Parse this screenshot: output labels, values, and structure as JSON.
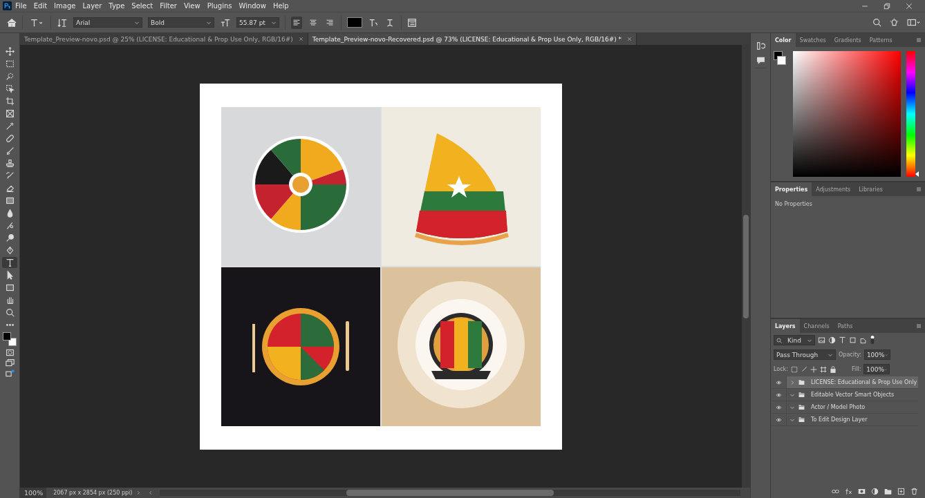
{
  "menu_bar": [
    "File",
    "Edit",
    "Image",
    "Layer",
    "Type",
    "Select",
    "Filter",
    "View",
    "Plugins",
    "Window",
    "Help"
  ],
  "options_bar": {
    "font_family": "Arial",
    "font_style": "Bold",
    "font_size": "55.87 pt",
    "align_buttons": [
      {
        "kind": "left",
        "selected": true
      },
      {
        "kind": "center",
        "selected": false
      },
      {
        "kind": "right",
        "selected": false
      }
    ]
  },
  "document_tabs": [
    {
      "label": "Template_Preview-novo.psd @ 25% (LICENSE: Educational & Prop Use Only, RGB/16#)",
      "selected": false
    },
    {
      "label": "Template_Preview-novo-Recovered.psd @ 73% (LICENSE: Educational & Prop Use Only, RGB/16#) *",
      "selected": true
    }
  ],
  "tools": [
    {
      "kind": "move",
      "selected": false
    },
    {
      "kind": "marquee",
      "selected": false
    },
    {
      "kind": "quick-select",
      "selected": false
    },
    {
      "kind": "object-select",
      "selected": false
    },
    {
      "kind": "crop",
      "selected": false
    },
    {
      "kind": "frame",
      "selected": false
    },
    {
      "kind": "eyedropper",
      "selected": false
    },
    {
      "kind": "healing",
      "selected": false
    },
    {
      "kind": "brush",
      "selected": false
    },
    {
      "kind": "stamp",
      "selected": false
    },
    {
      "kind": "history-brush",
      "selected": false
    },
    {
      "kind": "eraser",
      "selected": false
    },
    {
      "kind": "gradient",
      "selected": false
    },
    {
      "kind": "blur",
      "selected": false
    },
    {
      "kind": "smudge",
      "selected": false
    },
    {
      "kind": "dodge",
      "selected": false
    },
    {
      "kind": "pen",
      "selected": false
    },
    {
      "kind": "type",
      "selected": true
    },
    {
      "kind": "path-select",
      "selected": false
    },
    {
      "kind": "rectangle",
      "selected": false
    },
    {
      "kind": "hand",
      "selected": false
    },
    {
      "kind": "zoom",
      "selected": false
    },
    {
      "kind": "more",
      "selected": false
    }
  ],
  "color_panel": {
    "tabs": [
      {
        "label": "Color",
        "selected": true
      },
      {
        "label": "Swatches",
        "selected": false
      },
      {
        "label": "Gradients",
        "selected": false
      },
      {
        "label": "Patterns",
        "selected": false
      }
    ],
    "hue_slider": {
      "level": 0
    }
  },
  "properties_panel": {
    "tabs": [
      {
        "label": "Properties",
        "selected": true
      },
      {
        "label": "Adjustments",
        "selected": false
      },
      {
        "label": "Libraries",
        "selected": false
      }
    ],
    "message": "No Properties"
  },
  "layers_panel": {
    "tabs": [
      {
        "label": "Layers",
        "selected": true
      },
      {
        "label": "Channels",
        "selected": false
      },
      {
        "label": "Paths",
        "selected": false
      }
    ],
    "filter": "Kind",
    "blend_mode": "Pass Through",
    "opacity_label": "Opacity:",
    "opacity": "100%",
    "lock_label": "Lock:",
    "fill_label": "Fill:",
    "fill": "100%",
    "layers": [
      {
        "name": "LICENSE: Educational & Prop Use Only",
        "visible": true,
        "expanded": false,
        "selected": true
      },
      {
        "name": "Editable Vector Smart Objects",
        "visible": true,
        "expanded": true,
        "selected": false
      },
      {
        "name": "Actor / Model Photo",
        "visible": true,
        "expanded": true,
        "selected": false
      },
      {
        "name": "To Edit Design Layer",
        "visible": true,
        "expanded": true,
        "selected": false
      }
    ]
  },
  "status_bar": {
    "zoom": "100%",
    "document_info": "2067 px x 2854 px (250 ppi)"
  }
}
